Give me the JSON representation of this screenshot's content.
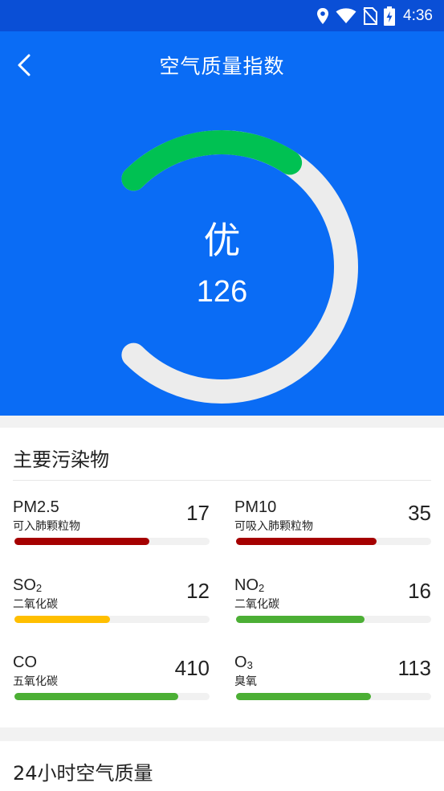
{
  "status_bar": {
    "time": "4:36"
  },
  "header": {
    "title": "空气质量指数"
  },
  "gauge": {
    "level": "优",
    "value": "126",
    "progress": 0.29,
    "track_color": "#ececec",
    "fill_color": "#00c152"
  },
  "pollutants": {
    "title": "主要污染物",
    "items": [
      {
        "name": "PM2.5",
        "sub": "",
        "desc": "可入肺颗粒物",
        "value": "17",
        "fill": 0.69,
        "color": "#a50000"
      },
      {
        "name": "PM10",
        "sub": "",
        "desc": "可吸入肺颗粒物",
        "value": "35",
        "fill": 0.72,
        "color": "#a50000"
      },
      {
        "name": "SO",
        "sub": "2",
        "desc": "二氧化碳",
        "value": "12",
        "fill": 0.49,
        "color": "#ffbf00"
      },
      {
        "name": "NO",
        "sub": "2",
        "desc": "二氧化碳",
        "value": "16",
        "fill": 0.66,
        "color": "#4caf35"
      },
      {
        "name": "CO",
        "sub": "",
        "desc": "五氧化碳",
        "value": "410",
        "fill": 0.84,
        "color": "#4caf35"
      },
      {
        "name": "O",
        "sub": "3",
        "desc": "臭氧",
        "value": "113",
        "fill": 0.69,
        "color": "#4caf35"
      }
    ]
  },
  "hourly": {
    "title": "24小时空气质量"
  }
}
